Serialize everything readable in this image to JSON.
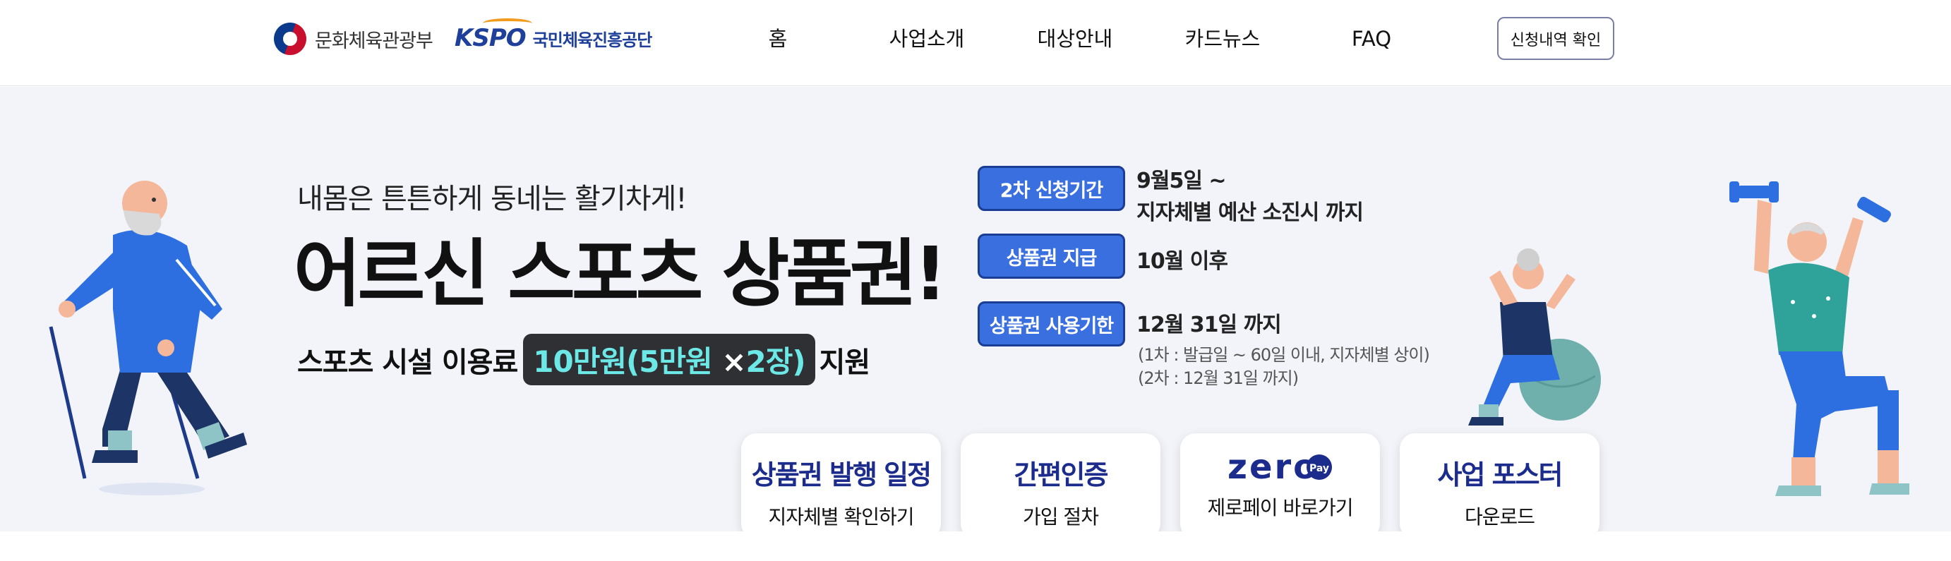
{
  "header": {
    "ministry_logo_text": "문화체육관광부",
    "kspo_logo_mark": "KSPO",
    "kspo_logo_text": "국민체육진흥공단",
    "nav": [
      {
        "label": "홈"
      },
      {
        "label": "사업소개"
      },
      {
        "label": "대상안내"
      },
      {
        "label": "카드뉴스"
      },
      {
        "label": "FAQ"
      }
    ],
    "apply_check_label": "신청내역 확인"
  },
  "hero": {
    "slogan": "내몸은 튼튼하게 동네는 활기차게!",
    "title": "어르신 스포츠 상품권!",
    "subline_prefix": "스포츠 시설 이용료",
    "subline_amount": "10만원",
    "subline_detail_open": "(5만원",
    "subline_times": "×",
    "subline_detail_close": "2장)",
    "subline_suffix": "지원",
    "rows": [
      {
        "tag": "2차 신청기간",
        "lines": [
          "9월5일 ~",
          "지자체별 예산 소진시 까지"
        ]
      },
      {
        "tag": "상품권 지급",
        "lines": [
          "10월 이후"
        ]
      },
      {
        "tag": "상품권 사용기한",
        "lines": [
          "12월 31일 까지"
        ],
        "notes": [
          "(1차 : 발급일 ~ 60일 이내, 지자체별 상이)",
          "(2차 : 12월 31일 까지)"
        ]
      }
    ],
    "cards": [
      {
        "title": "상품권 발행 일정",
        "sub": "지자체별 확인하기"
      },
      {
        "title": "간편인증",
        "sub": "가입 절차"
      },
      {
        "title_logo": "zero",
        "title_logo_badge": "Pay",
        "sub": "제로페이 바로가기"
      },
      {
        "title": "사업 포스터",
        "sub": "다운로드"
      }
    ]
  },
  "colors": {
    "accent_blue": "#3a6fe0",
    "dark_navy": "#1c2c8c",
    "highlight_cyan": "#6ce8e6",
    "hero_bg": "#f2f4f9"
  }
}
